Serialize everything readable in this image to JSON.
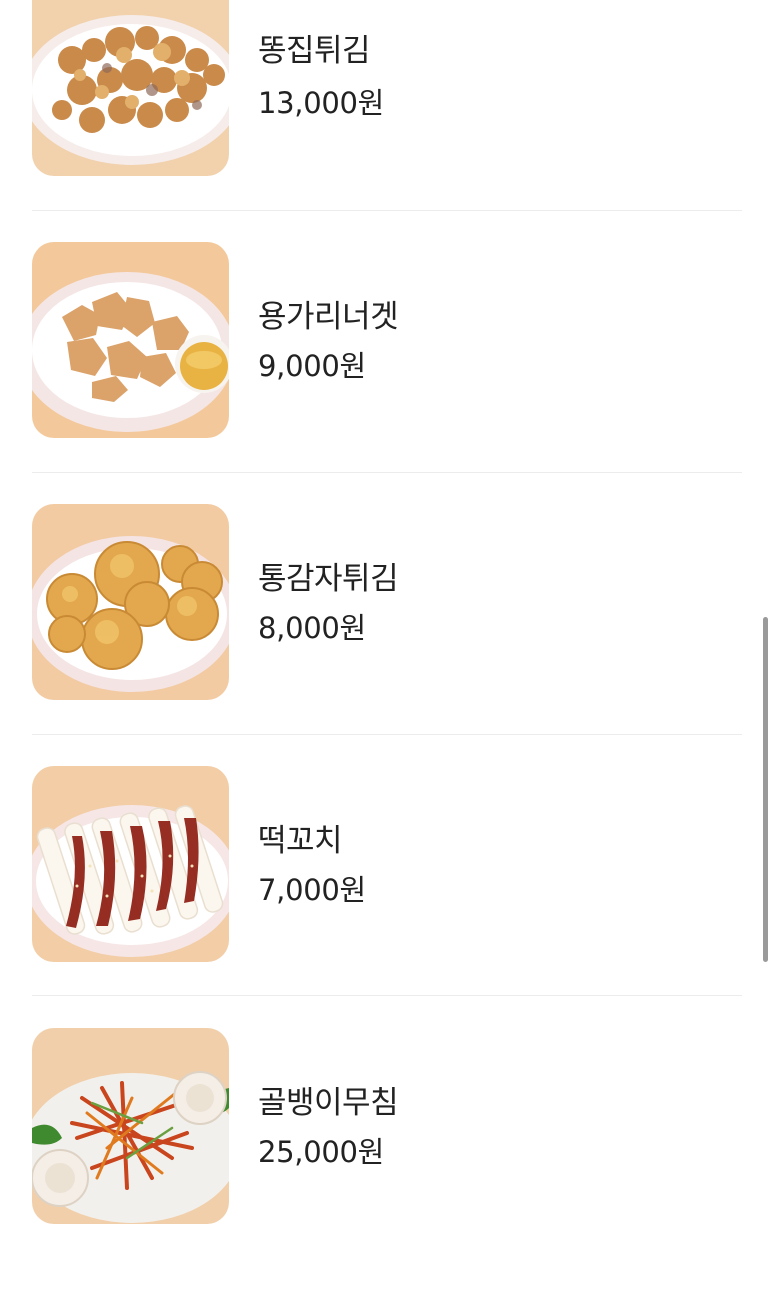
{
  "menu": {
    "items": [
      {
        "name": "똥집튀김",
        "price": "13,000원"
      },
      {
        "name": "용가리너겟",
        "price": "9,000원"
      },
      {
        "name": "통감자튀김",
        "price": "8,000원"
      },
      {
        "name": "떡꼬치",
        "price": "7,000원"
      },
      {
        "name": "골뱅이무침",
        "price": "25,000원"
      }
    ]
  },
  "colors": {
    "background_peach": "#f2cfa8",
    "fried_gold": "#d9a45c",
    "sauce_red": "#8e1d12",
    "text": "#222222",
    "divider": "#ececec"
  }
}
